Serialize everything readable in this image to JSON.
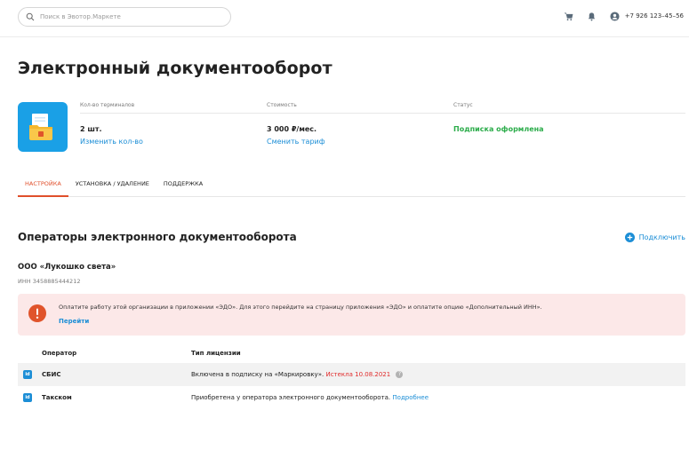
{
  "header": {
    "search_placeholder": "Поиск в Эвотор.Маркете",
    "phone": "+7 926 123–45–56",
    "icons": [
      "search-icon",
      "cart-icon",
      "bell-icon",
      "user-icon"
    ]
  },
  "page": {
    "title": "Электронный документооборот"
  },
  "summary": {
    "terminals_label": "Кол-во терминалов",
    "terminals_value": "2 шт.",
    "terminals_link": "Изменить кол-во",
    "price_label": "Стоимость",
    "price_value": "3 000 ₽/мес.",
    "price_link": "Сменить тариф",
    "status_label": "Статус",
    "status_value": "Подписка оформлена"
  },
  "tabs": [
    {
      "label": "Настройка",
      "active": true
    },
    {
      "label": "Установка / удаление",
      "active": false
    },
    {
      "label": "Поддержка",
      "active": false
    }
  ],
  "operators": {
    "section_title": "Операторы электронного документооборота",
    "connect_label": "Подключить",
    "org_name": "ООО «Лукошко света»",
    "org_inn": "ИНН 3458885444212",
    "alert_text": "Оплатите работу этой организации в приложении «ЭДО». Для этого перейдите на страницу приложения «ЭДО» и оплатите опцию «Дополнительный ИНН».",
    "alert_link": "Перейти",
    "col_operator": "Оператор",
    "col_license": "Тип лицензии",
    "rows": [
      {
        "badge": "id",
        "name": "СБИС",
        "license": "Включена в подписку на «Маркировку».",
        "license_extra": "Истекла 10.08.2021",
        "help": "?"
      },
      {
        "badge": "id",
        "name": "Такском",
        "license": "Приобретена у оператора электронного документооборота.",
        "license_link": "Подробнее"
      }
    ]
  },
  "colors": {
    "accent": "#e04f2b",
    "link": "#1c8ed6",
    "success": "#2bac4a",
    "error": "#e02b2b",
    "alert_bg": "#fce8e8",
    "app_icon_bg": "#1aa0e6"
  }
}
